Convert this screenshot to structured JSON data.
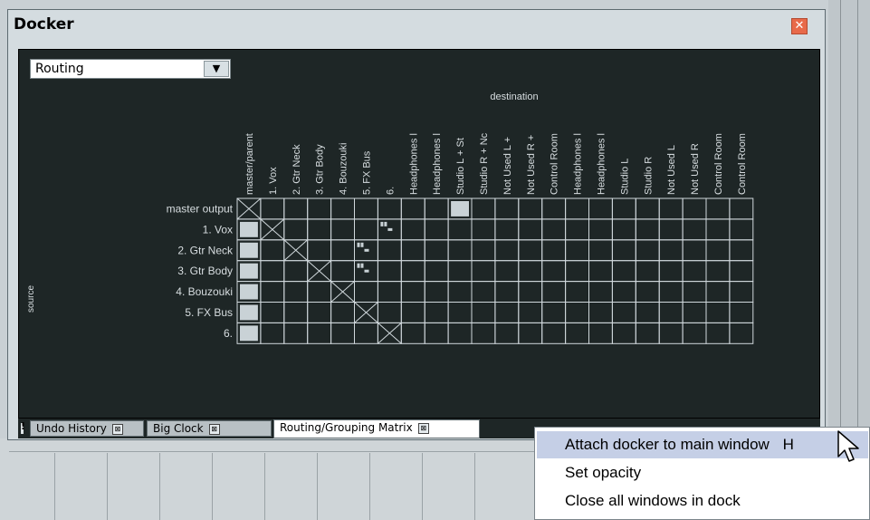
{
  "docker": {
    "title": "Docker",
    "close_glyph": "✕",
    "view_select": "Routing",
    "dropdown_glyph": "▼"
  },
  "matrix": {
    "destination_label": "destination",
    "source_label": "source",
    "columns": [
      "master/parent",
      "1. Vox",
      "2. Gtr Neck",
      "3. Gtr Body",
      "4. Bouzouki",
      "5. FX Bus",
      "6.",
      "Headphones l",
      "Headphones l",
      "Studio L + St",
      "Studio R + Nc",
      "Not Used L +",
      "Not Used R +",
      "Control Room",
      "Headphones l",
      "Headphones l",
      "Studio L",
      "Studio R",
      "Not Used L",
      "Not Used R",
      "Control Room",
      "Control Room"
    ],
    "rows": [
      "master output",
      "1. Vox",
      "2. Gtr Neck",
      "3. Gtr Body",
      "4. Bouzouki",
      "5. FX Bus",
      "6."
    ],
    "filled_cells": [
      [
        0,
        9
      ],
      [
        1,
        0
      ],
      [
        2,
        0
      ],
      [
        3,
        0
      ],
      [
        4,
        0
      ],
      [
        5,
        0
      ],
      [
        6,
        0
      ]
    ],
    "crossed_cells": [
      [
        0,
        0
      ],
      [
        1,
        1
      ],
      [
        2,
        2
      ],
      [
        3,
        3
      ],
      [
        4,
        4
      ],
      [
        5,
        5
      ],
      [
        6,
        6
      ]
    ],
    "channel_mark_cells": [
      [
        1,
        6
      ],
      [
        2,
        5
      ],
      [
        3,
        5
      ]
    ],
    "colors": {
      "grid": "#d0d8dc",
      "panel": "#1e2626",
      "filled": "#c9d2d6",
      "text": "#d7dde0"
    }
  },
  "tabs": [
    {
      "label": "Undo History",
      "close": "⊠"
    },
    {
      "label": "Big Clock",
      "close": "⊠"
    },
    {
      "label": "Routing/Grouping Matrix",
      "close": "⊠"
    }
  ],
  "tab_marker": "!",
  "context_menu": {
    "items": [
      {
        "label": "Attach docker to main window",
        "suffix": "H"
      },
      {
        "label": "Set opacity"
      },
      {
        "label": "Close all windows in dock"
      }
    ]
  }
}
